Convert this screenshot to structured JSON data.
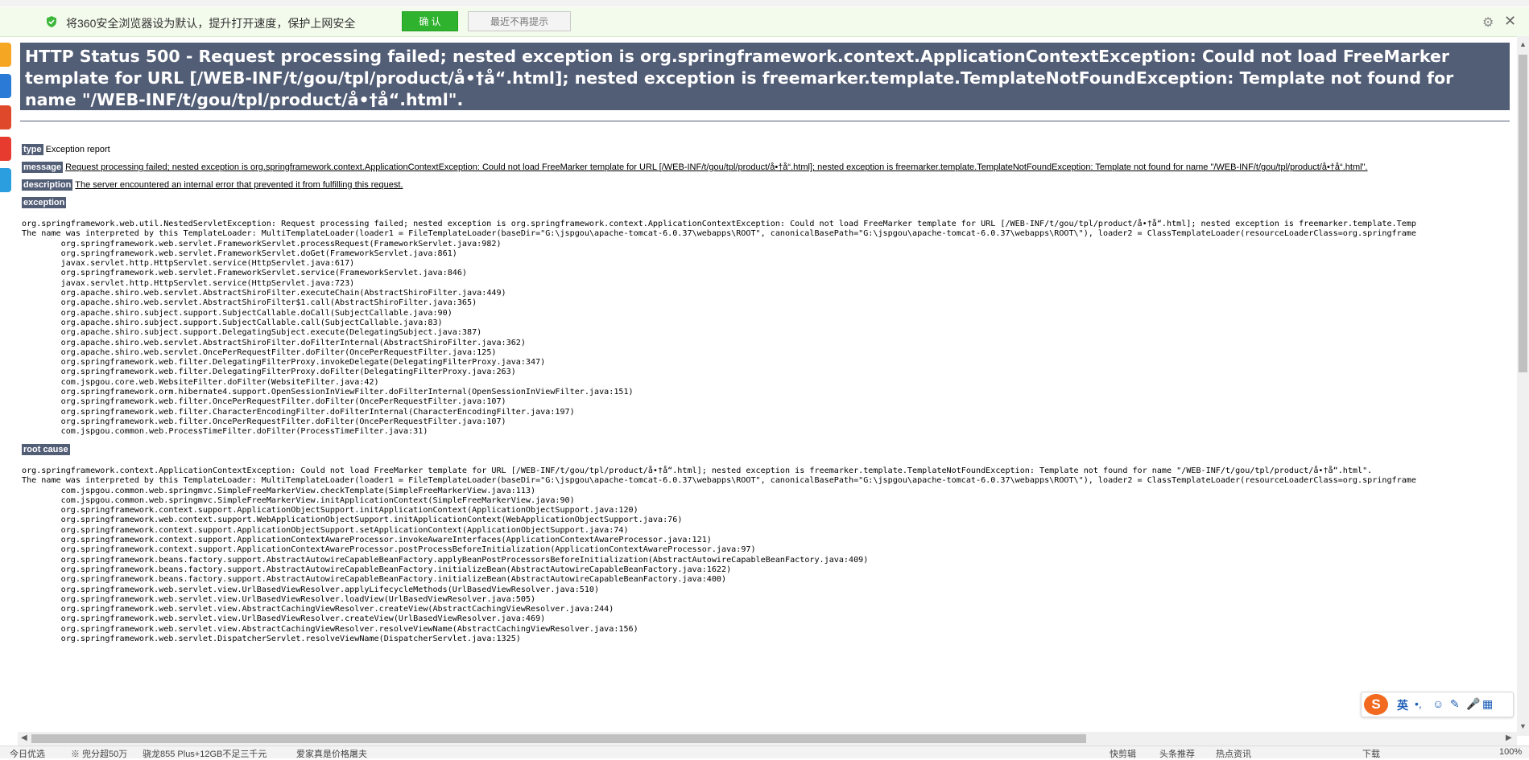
{
  "infobar": {
    "message": "将360安全浏览器设为默认，提升打开速度，保护上网安全",
    "confirm_label": "确 认",
    "dismiss_label": "最近不再提示",
    "settings_glyph": "⚙",
    "close_glyph": "✕"
  },
  "page": {
    "title": "HTTP Status 500 - Request processing failed; nested exception is org.springframework.context.ApplicationContextException: Could not load FreeMarker template for URL [/WEB-INF/t/gou/tpl/product/å•†å“.html]; nested exception is freemarker.template.TemplateNotFoundException: Template not found for name \"/WEB-INF/t/gou/tpl/product/å•†å“.html\".",
    "type_label": "type",
    "type_value": "Exception report",
    "message_label": "message",
    "message_value": "Request processing failed; nested exception is org.springframework.context.ApplicationContextException: Could not load FreeMarker template for URL [/WEB-INF/t/gou/tpl/product/å•†å“.html]; nested exception is freemarker.template.TemplateNotFoundException: Template not found for name \"/WEB-INF/t/gou/tpl/product/å•†å“.html\".",
    "description_label": "description",
    "description_value": "The server encountered an internal error that prevented it from fulfilling this request.",
    "exception_label": "exception",
    "exception_trace": "org.springframework.web.util.NestedServletException: Request processing failed; nested exception is org.springframework.context.ApplicationContextException: Could not load FreeMarker template for URL [/WEB-INF/t/gou/tpl/product/å•†å“.html]; nested exception is freemarker.template.Temp\nThe name was interpreted by this TemplateLoader: MultiTemplateLoader(loader1 = FileTemplateLoader(baseDir=\"G:\\jspgou\\apache-tomcat-6.0.37\\webapps\\ROOT\", canonicalBasePath=\"G:\\jspgou\\apache-tomcat-6.0.37\\webapps\\ROOT\\\"), loader2 = ClassTemplateLoader(resourceLoaderClass=org.springframe\n\torg.springframework.web.servlet.FrameworkServlet.processRequest(FrameworkServlet.java:982)\n\torg.springframework.web.servlet.FrameworkServlet.doGet(FrameworkServlet.java:861)\n\tjavax.servlet.http.HttpServlet.service(HttpServlet.java:617)\n\torg.springframework.web.servlet.FrameworkServlet.service(FrameworkServlet.java:846)\n\tjavax.servlet.http.HttpServlet.service(HttpServlet.java:723)\n\torg.apache.shiro.web.servlet.AbstractShiroFilter.executeChain(AbstractShiroFilter.java:449)\n\torg.apache.shiro.web.servlet.AbstractShiroFilter$1.call(AbstractShiroFilter.java:365)\n\torg.apache.shiro.subject.support.SubjectCallable.doCall(SubjectCallable.java:90)\n\torg.apache.shiro.subject.support.SubjectCallable.call(SubjectCallable.java:83)\n\torg.apache.shiro.subject.support.DelegatingSubject.execute(DelegatingSubject.java:387)\n\torg.apache.shiro.web.servlet.AbstractShiroFilter.doFilterInternal(AbstractShiroFilter.java:362)\n\torg.apache.shiro.web.servlet.OncePerRequestFilter.doFilter(OncePerRequestFilter.java:125)\n\torg.springframework.web.filter.DelegatingFilterProxy.invokeDelegate(DelegatingFilterProxy.java:347)\n\torg.springframework.web.filter.DelegatingFilterProxy.doFilter(DelegatingFilterProxy.java:263)\n\tcom.jspgou.core.web.WebsiteFilter.doFilter(WebsiteFilter.java:42)\n\torg.springframework.orm.hibernate4.support.OpenSessionInViewFilter.doFilterInternal(OpenSessionInViewFilter.java:151)\n\torg.springframework.web.filter.OncePerRequestFilter.doFilter(OncePerRequestFilter.java:107)\n\torg.springframework.web.filter.CharacterEncodingFilter.doFilterInternal(CharacterEncodingFilter.java:197)\n\torg.springframework.web.filter.OncePerRequestFilter.doFilter(OncePerRequestFilter.java:107)\n\tcom.jspgou.common.web.ProcessTimeFilter.doFilter(ProcessTimeFilter.java:31)",
    "root_cause_label": "root cause",
    "root_cause_trace": "org.springframework.context.ApplicationContextException: Could not load FreeMarker template for URL [/WEB-INF/t/gou/tpl/product/å•†å“.html]; nested exception is freemarker.template.TemplateNotFoundException: Template not found for name \"/WEB-INF/t/gou/tpl/product/å•†å“.html\".\nThe name was interpreted by this TemplateLoader: MultiTemplateLoader(loader1 = FileTemplateLoader(baseDir=\"G:\\jspgou\\apache-tomcat-6.0.37\\webapps\\ROOT\", canonicalBasePath=\"G:\\jspgou\\apache-tomcat-6.0.37\\webapps\\ROOT\\\"), loader2 = ClassTemplateLoader(resourceLoaderClass=org.springframe\n\tcom.jspgou.common.web.springmvc.SimpleFreeMarkerView.checkTemplate(SimpleFreeMarkerView.java:113)\n\tcom.jspgou.common.web.springmvc.SimpleFreeMarkerView.initApplicationContext(SimpleFreeMarkerView.java:90)\n\torg.springframework.context.support.ApplicationObjectSupport.initApplicationContext(ApplicationObjectSupport.java:120)\n\torg.springframework.web.context.support.WebApplicationObjectSupport.initApplicationContext(WebApplicationObjectSupport.java:76)\n\torg.springframework.context.support.ApplicationObjectSupport.setApplicationContext(ApplicationObjectSupport.java:74)\n\torg.springframework.context.support.ApplicationContextAwareProcessor.invokeAwareInterfaces(ApplicationContextAwareProcessor.java:121)\n\torg.springframework.context.support.ApplicationContextAwareProcessor.postProcessBeforeInitialization(ApplicationContextAwareProcessor.java:97)\n\torg.springframework.beans.factory.support.AbstractAutowireCapableBeanFactory.applyBeanPostProcessorsBeforeInitialization(AbstractAutowireCapableBeanFactory.java:409)\n\torg.springframework.beans.factory.support.AbstractAutowireCapableBeanFactory.initializeBean(AbstractAutowireCapableBeanFactory.java:1622)\n\torg.springframework.beans.factory.support.AbstractAutowireCapableBeanFactory.initializeBean(AbstractAutowireCapableBeanFactory.java:400)\n\torg.springframework.web.servlet.view.UrlBasedViewResolver.applyLifecycleMethods(UrlBasedViewResolver.java:510)\n\torg.springframework.web.servlet.view.UrlBasedViewResolver.loadView(UrlBasedViewResolver.java:505)\n\torg.springframework.web.servlet.view.AbstractCachingViewResolver.createView(AbstractCachingViewResolver.java:244)\n\torg.springframework.web.servlet.view.UrlBasedViewResolver.createView(UrlBasedViewResolver.java:469)\n\torg.springframework.web.servlet.view.AbstractCachingViewResolver.resolveViewName(AbstractCachingViewResolver.java:156)\n\torg.springframework.web.servlet.DispatcherServlet.resolveViewName(DispatcherServlet.java:1325)"
  },
  "ime": {
    "logo": "S",
    "lang": "英",
    "punct": "•,",
    "emoji": "☺",
    "pen": "✎",
    "mic": "🎤",
    "grid": "▦"
  },
  "statusbar": {
    "today": "今日优选",
    "news1": "※ 兜分超50万",
    "news2": "骁龙855 Plus+12GB不足三千元",
    "news3": "爱家真是价格屠夫",
    "quick_clip": "快剪辑",
    "headline": "头条推荐",
    "hot": "热点资讯",
    "download": "下载",
    "zoom": "100%"
  },
  "colors": {
    "title_bar": "#525d76",
    "infobar_bg": "#f3fbec",
    "confirm_btn": "#2fb32f",
    "sidebar": [
      "#f5a623",
      "#2a7ad6",
      "#e0482b",
      "#e63b2e",
      "#2b9ee0"
    ]
  }
}
